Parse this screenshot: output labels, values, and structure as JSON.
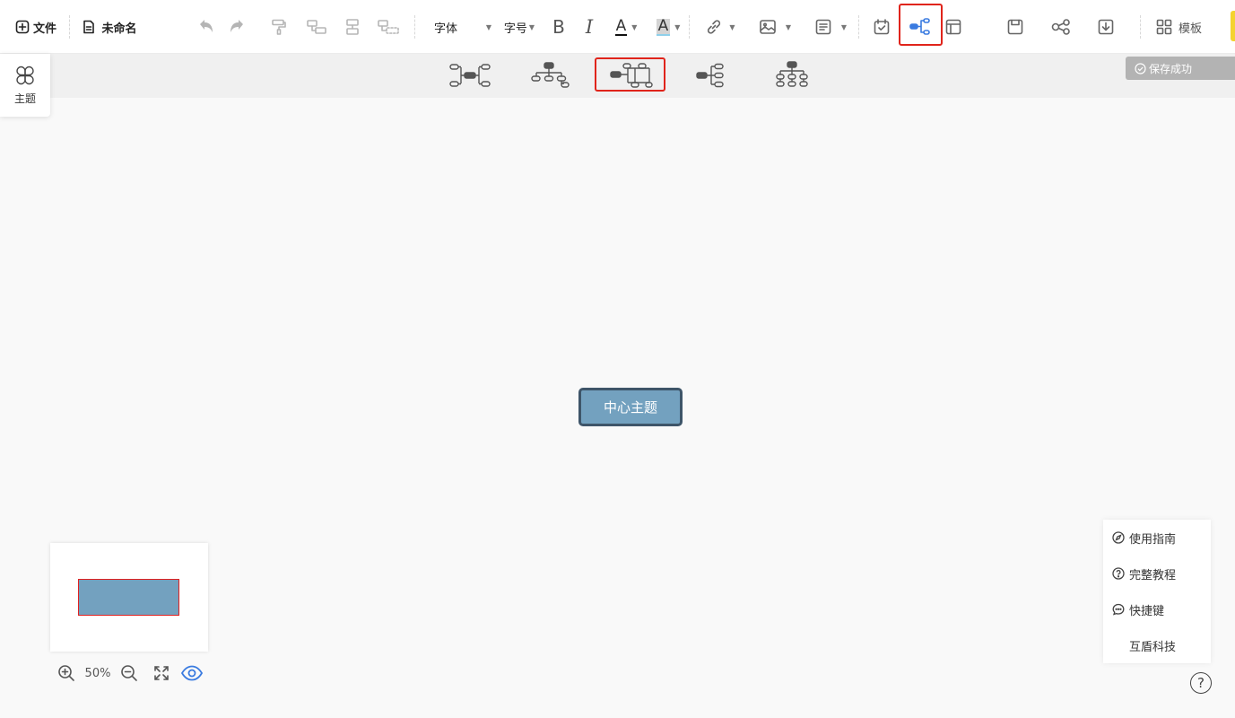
{
  "toolbar": {
    "file_label": "文件",
    "doc_title": "未命名",
    "font_label": "字体",
    "size_label": "字号",
    "bold_glyph": "B",
    "italic_glyph": "I",
    "font_color_glyph": "A",
    "bg_color_glyph": "A",
    "template_label": "模板"
  },
  "save_status": "保存成功",
  "theme_panel": {
    "label": "主题"
  },
  "canvas": {
    "center_topic": "中心主题"
  },
  "zoom": {
    "value": "50%"
  },
  "help_menu": {
    "items": [
      {
        "label": "使用指南",
        "icon": "compass-icon"
      },
      {
        "label": "完整教程",
        "icon": "question-circle-icon"
      },
      {
        "label": "快捷键",
        "icon": "chat-bubble-icon"
      },
      {
        "label": "互盾科技",
        "icon": ""
      }
    ],
    "help_button": "?"
  },
  "structures": [
    {
      "name": "mindmap-both-sides",
      "selected": false
    },
    {
      "name": "org-chart-down",
      "selected": false
    },
    {
      "name": "right-tree-branches",
      "selected": true
    },
    {
      "name": "logic-right",
      "selected": false
    },
    {
      "name": "org-chart-tiered",
      "selected": false
    }
  ],
  "colors": {
    "accent": "#3a7be0",
    "highlight_red": "#e0241b",
    "node_fill": "#73a1bf",
    "node_border": "#3e5569"
  }
}
